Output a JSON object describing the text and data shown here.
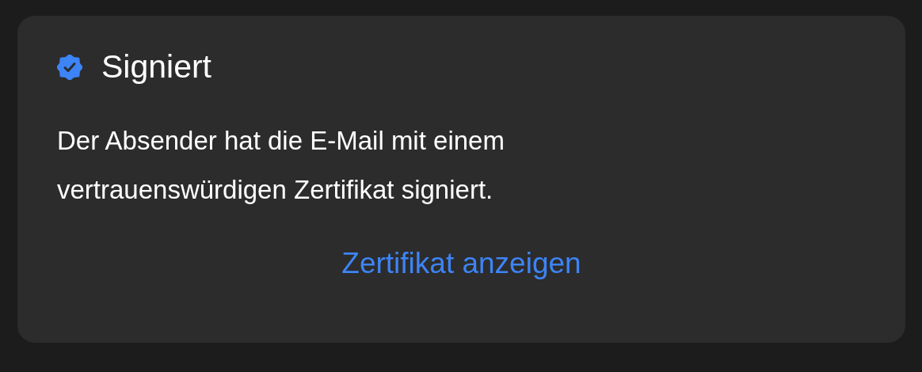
{
  "card": {
    "title": "Signiert",
    "verified": true,
    "message": "Der Absender hat die E-Mail mit einem vertrauenswürdigen Zertifikat signiert.",
    "link": "Zertifikat anzeigen"
  }
}
